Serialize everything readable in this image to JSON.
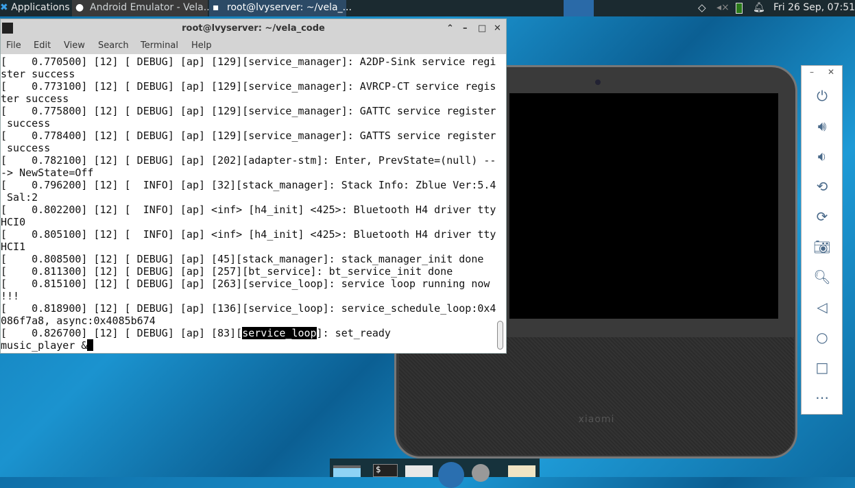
{
  "topbar": {
    "applications": "Applications",
    "tasks": [
      "Android Emulator - Vela...",
      "root@lvyserver: ~/vela_..."
    ],
    "clock": "Fri 26 Sep, 07:51"
  },
  "terminal": {
    "title": "root@lvyserver: ~/vela_code",
    "menu": [
      "File",
      "Edit",
      "View",
      "Search",
      "Terminal",
      "Help"
    ],
    "lines": [
      "[    0.770500] [12] [ DEBUG] [ap] [129][service_manager]: A2DP-Sink service regi",
      "ster success",
      "[    0.773100] [12] [ DEBUG] [ap] [129][service_manager]: AVRCP-CT service regis",
      "ter success",
      "[    0.775800] [12] [ DEBUG] [ap] [129][service_manager]: GATTC service register",
      " success",
      "[    0.778400] [12] [ DEBUG] [ap] [129][service_manager]: GATTS service register",
      " success",
      "[    0.782100] [12] [ DEBUG] [ap] [202][adapter-stm]: Enter, PrevState=(null) --",
      "-> NewState=Off",
      "[    0.796200] [12] [  INFO] [ap] [32][stack_manager]: Stack Info: Zblue Ver:5.4",
      " Sal:2",
      "[    0.802200] [12] [  INFO] [ap] <inf> [h4_init] <425>: Bluetooth H4 driver tty",
      "HCI0",
      "[    0.805100] [12] [  INFO] [ap] <inf> [h4_init] <425>: Bluetooth H4 driver tty",
      "HCI1",
      "[    0.808500] [12] [ DEBUG] [ap] [45][stack_manager]: stack_manager_init done",
      "[    0.811300] [12] [ DEBUG] [ap] [257][bt_service]: bt_service_init done",
      "[    0.815100] [12] [ DEBUG] [ap] [263][service_loop]: service loop running now",
      "!!!",
      "[    0.818900] [12] [ DEBUG] [ap] [136][service_loop]: service_schedule_loop:0x4",
      "086f7a8, async:0x4085b674"
    ],
    "last_prefix": "[    0.826700] [12] [ DEBUG] [ap] [83][",
    "last_highlight": "service_loop",
    "last_suffix": "]: set_ready",
    "input": "music_player &"
  },
  "device": {
    "brand": "xiaomi"
  },
  "side_toolbar": [
    "power-icon",
    "volume-up-icon",
    "volume-down-icon",
    "rotate-left-icon",
    "rotate-right-icon",
    "camera-icon",
    "zoom-icon",
    "back-icon",
    "home-icon",
    "overview-icon",
    "more-icon"
  ]
}
